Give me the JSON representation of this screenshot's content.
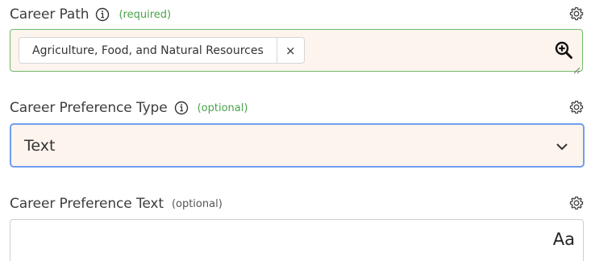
{
  "career_path": {
    "label": "Career Path",
    "hint": "(required)",
    "chip_label": "Agriculture, Food, and Natural Resources",
    "chip_remove": "×"
  },
  "career_preference_type": {
    "label": "Career Preference Type",
    "hint": "(optional)",
    "selected_value": "Text"
  },
  "career_preference_text": {
    "label": "Career Preference Text",
    "hint": "(optional)",
    "value": "",
    "format_icon_text": "Aa"
  },
  "colors": {
    "required_hint": "#4aa34a",
    "valid_border": "#6fba6a",
    "focus_border": "#6f9ef0",
    "field_bg": "#fdf4ee"
  },
  "icons": {
    "info": "info-circle-icon",
    "settings": "gear-icon",
    "lookup": "zoom-in-icon",
    "dropdown": "chevron-down-icon",
    "text_format": "text-format-icon"
  }
}
